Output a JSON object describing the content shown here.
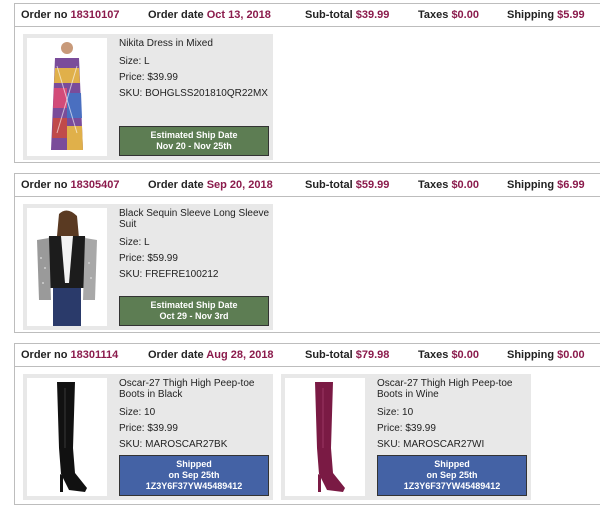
{
  "orders": [
    {
      "order_label": "Order no",
      "order_no": "18310107",
      "date_label": "Order date",
      "date": "Oct 13, 2018",
      "subtotal_label": "Sub-total",
      "subtotal": "$39.99",
      "taxes_label": "Taxes",
      "taxes": "$0.00",
      "shipping_label": "Shipping",
      "shipping": "$5.99",
      "items": [
        {
          "name": "Nikita Dress in Mixed",
          "size": "Size: L",
          "price": "Price: $39.99",
          "sku": "SKU: BOHGLSS201810QR22MX",
          "badge_line1": "Estimated Ship Date",
          "badge_line2": "Nov 20 - Nov 25th",
          "badge_line3": ""
        }
      ]
    },
    {
      "order_label": "Order no",
      "order_no": "18305407",
      "date_label": "Order date",
      "date": "Sep 20, 2018",
      "subtotal_label": "Sub-total",
      "subtotal": "$59.99",
      "taxes_label": "Taxes",
      "taxes": "$0.00",
      "shipping_label": "Shipping",
      "shipping": "$6.99",
      "items": [
        {
          "name": "Black Sequin Sleeve Long Sleeve Suit",
          "size": "Size: L",
          "price": "Price: $59.99",
          "sku": "SKU: FREFRE100212",
          "badge_line1": "Estimated Ship Date",
          "badge_line2": "Oct 29 - Nov 3rd",
          "badge_line3": ""
        }
      ]
    },
    {
      "order_label": "Order no",
      "order_no": "18301114",
      "date_label": "Order date",
      "date": "Aug 28, 2018",
      "subtotal_label": "Sub-total",
      "subtotal": "$79.98",
      "taxes_label": "Taxes",
      "taxes": "$0.00",
      "shipping_label": "Shipping",
      "shipping": "$0.00",
      "items": [
        {
          "name": "Oscar-27 Thigh High Peep-toe Boots in Black",
          "size": "Size: 10",
          "price": "Price: $39.99",
          "sku": "SKU: MAROSCAR27BK",
          "badge_line1": "Shipped",
          "badge_line2": "on Sep 25th",
          "badge_line3": "1Z3Y6F37YW45489412"
        },
        {
          "name": "Oscar-27 Thigh High Peep-toe Boots in Wine",
          "size": "Size: 10",
          "price": "Price: $39.99",
          "sku": "SKU: MAROSCAR27WI",
          "badge_line1": "Shipped",
          "badge_line2": "on Sep 25th",
          "badge_line3": "1Z3Y6F37YW45489412"
        }
      ]
    }
  ],
  "colors": {
    "accent_value": "#8b1b4c",
    "badge_estimated": "#5d7d53",
    "badge_shipped": "#4462a5",
    "card_bg": "#e8e8e8"
  },
  "icons": {
    "item1": "dress-photo",
    "item2": "jacket-photo",
    "item3": "black-boot-photo",
    "item4": "wine-boot-photo"
  }
}
